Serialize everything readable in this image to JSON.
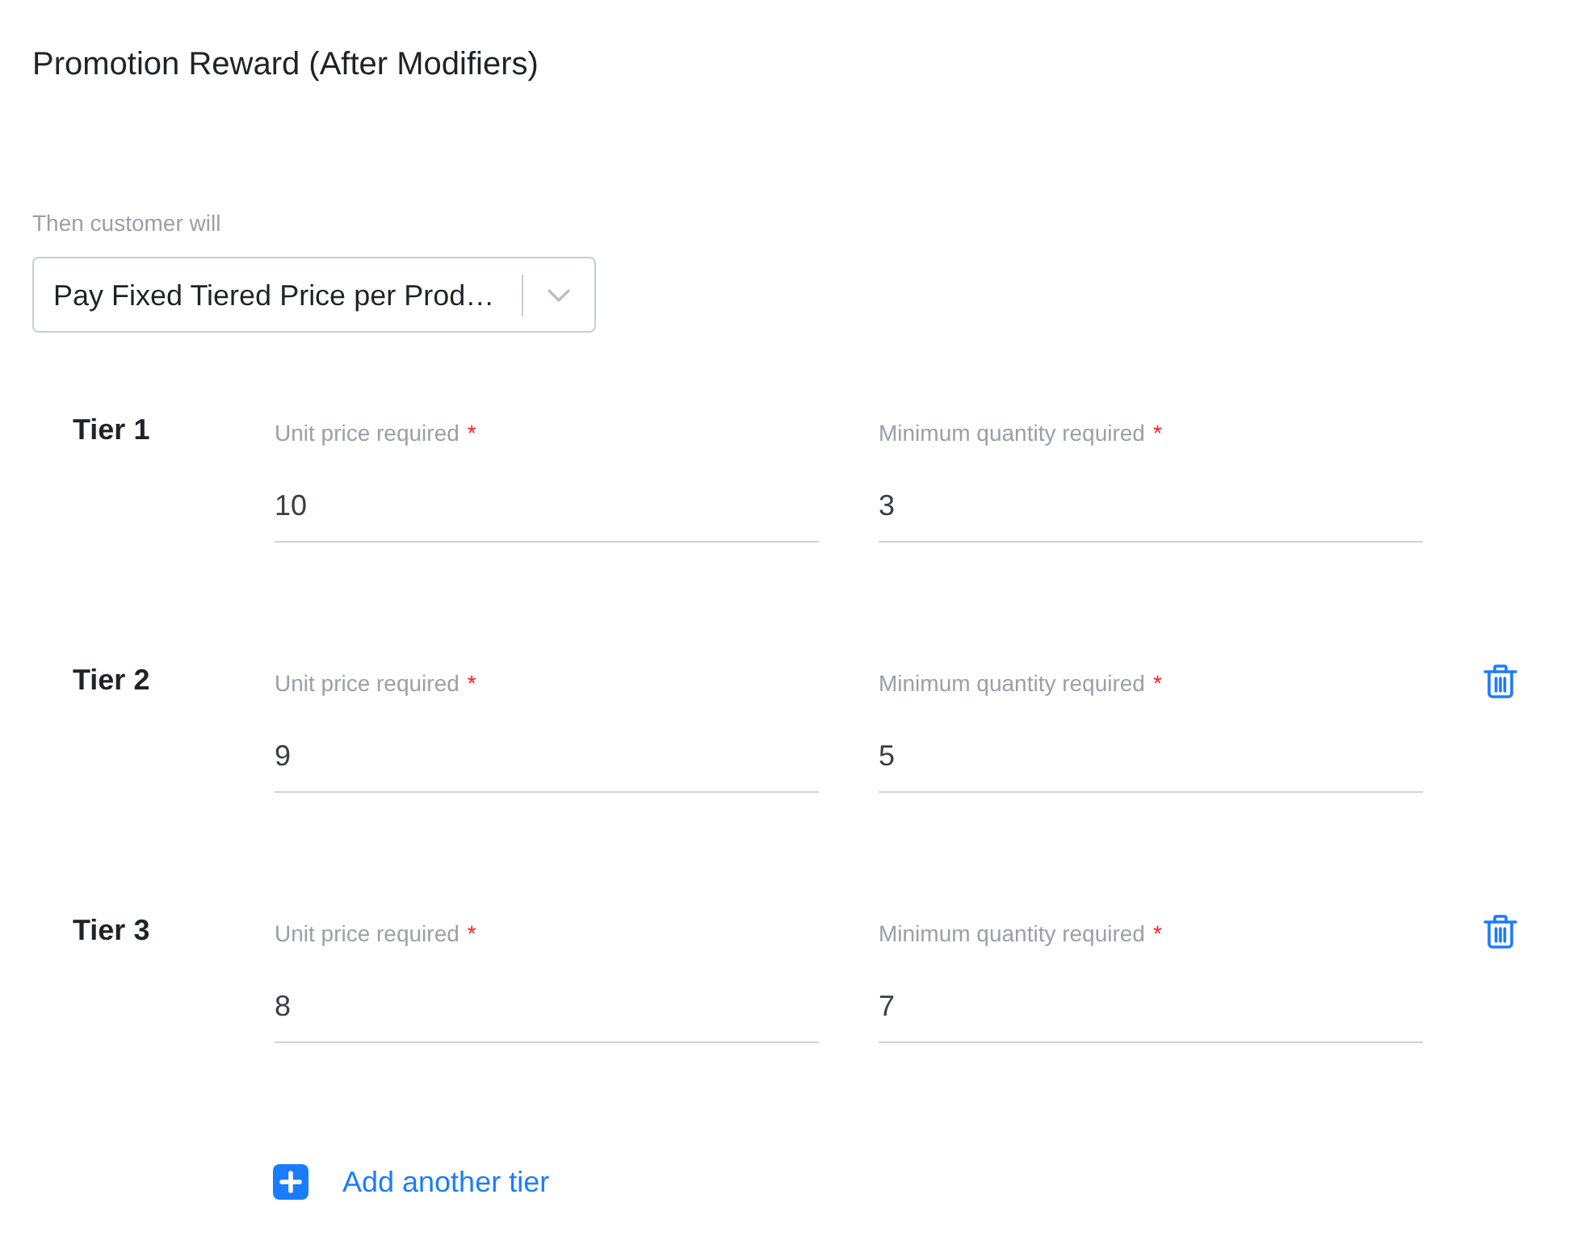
{
  "section": {
    "title": "Promotion Reward (After Modifiers)"
  },
  "reward_select": {
    "label": "Then customer will",
    "value": "Pay Fixed Tiered Price per Prod…"
  },
  "tiers": [
    {
      "label": "Tier 1",
      "deletable": false,
      "fields": [
        {
          "label": "Unit price required",
          "required_mark": "*",
          "value": "10"
        },
        {
          "label": "Minimum quantity required",
          "required_mark": "*",
          "value": "3"
        }
      ]
    },
    {
      "label": "Tier 2",
      "deletable": true,
      "fields": [
        {
          "label": "Unit price required",
          "required_mark": "*",
          "value": "9"
        },
        {
          "label": "Minimum quantity required",
          "required_mark": "*",
          "value": "5"
        }
      ]
    },
    {
      "label": "Tier 3",
      "deletable": true,
      "fields": [
        {
          "label": "Unit price required",
          "required_mark": "*",
          "value": "8"
        },
        {
          "label": "Minimum quantity required",
          "required_mark": "*",
          "value": "7"
        }
      ]
    }
  ],
  "add_tier": {
    "label": "Add another tier"
  }
}
